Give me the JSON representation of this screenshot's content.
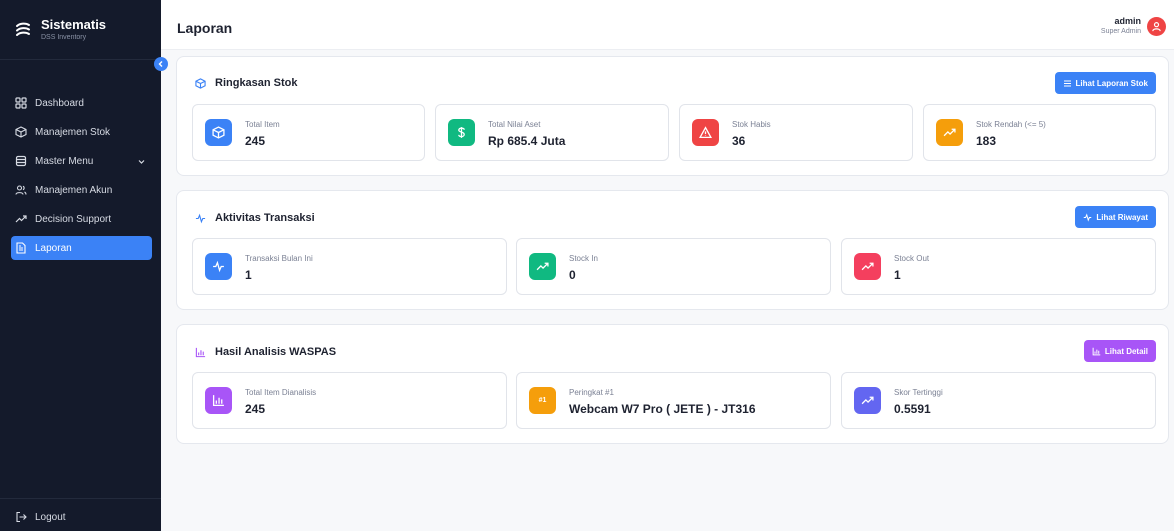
{
  "app": {
    "name": "Sistematis",
    "subtitle": "DSS Inventory"
  },
  "sidebar": {
    "items": [
      {
        "label": "Dashboard",
        "icon": "grid-icon"
      },
      {
        "label": "Manajemen Stok",
        "icon": "cube-icon"
      },
      {
        "label": "Master Menu",
        "icon": "database-icon",
        "expandable": true
      },
      {
        "label": "Manajemen Akun",
        "icon": "users-icon"
      },
      {
        "label": "Decision Support",
        "icon": "trending-up-icon"
      },
      {
        "label": "Laporan",
        "icon": "file-text-icon",
        "active": true
      }
    ],
    "logout_label": "Logout"
  },
  "header": {
    "title": "Laporan",
    "user_name": "admin",
    "user_role": "Super Admin"
  },
  "ringkasan": {
    "title": "Ringkasan Stok",
    "button": "Lihat Laporan Stok",
    "stats": [
      {
        "label": "Total Item",
        "value": "245",
        "color": "#3b82f6",
        "icon": "cube-icon"
      },
      {
        "label": "Total Nilai Aset",
        "value": "Rp 685.4 Juta",
        "color": "#10b981",
        "icon": "dollar-icon"
      },
      {
        "label": "Stok Habis",
        "value": "36",
        "color": "#ef4444",
        "icon": "warning-icon"
      },
      {
        "label": "Stok Rendah (<= 5)",
        "value": "183",
        "color": "#f59e0b",
        "icon": "trending-up-icon"
      }
    ]
  },
  "aktivitas": {
    "title": "Aktivitas Transaksi",
    "button": "Lihat Riwayat",
    "stats": [
      {
        "label": "Transaksi Bulan Ini",
        "value": "1",
        "color": "#3b82f6",
        "icon": "activity-icon"
      },
      {
        "label": "Stock In",
        "value": "0",
        "color": "#10b981",
        "icon": "trending-up-icon"
      },
      {
        "label": "Stock Out",
        "value": "1",
        "color": "#f43f5e",
        "icon": "trending-up-icon"
      }
    ]
  },
  "waspas": {
    "title": "Hasil Analisis WASPAS",
    "button": "Lihat Detail",
    "stats": [
      {
        "label": "Total Item Dianalisis",
        "value": "245",
        "color": "#a855f7",
        "icon": "bar-chart-icon"
      },
      {
        "label": "Peringkat #1",
        "value": "Webcam W7 Pro ( JETE ) - JT316",
        "color": "#f59e0b",
        "badge": "#1"
      },
      {
        "label": "Skor Tertinggi",
        "value": "0.5591",
        "color": "#6366f1",
        "icon": "trending-up-icon"
      }
    ]
  },
  "colors": {
    "sidebar_bg": "#141a2b",
    "primary": "#3b82f6",
    "purple": "#a855f7",
    "danger": "#ef4444"
  }
}
